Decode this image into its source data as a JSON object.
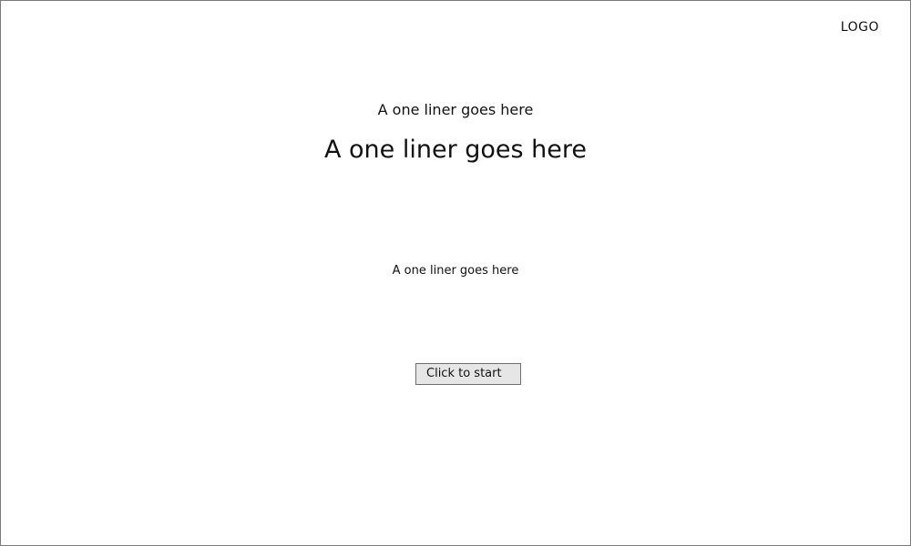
{
  "header": {
    "logo_text": "LOGO"
  },
  "hero": {
    "eyebrow": "A one liner goes here",
    "headline": "A one liner goes here",
    "subtext": "A one liner goes here"
  },
  "actions": {
    "start_label": "Click to start"
  }
}
